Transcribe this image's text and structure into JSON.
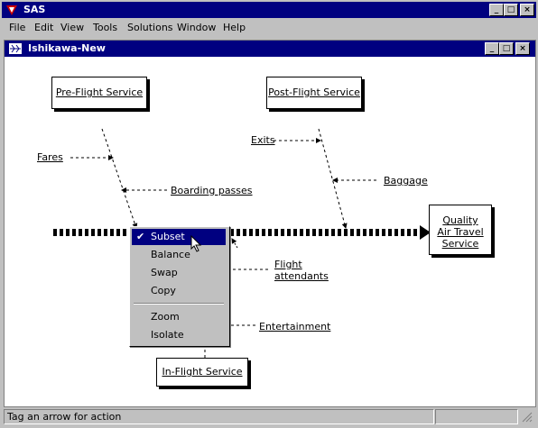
{
  "app": {
    "title": "SAS"
  },
  "menubar": [
    "File",
    "Edit",
    "View",
    "Tools",
    "Solutions",
    "Window",
    "Help"
  ],
  "child_window": {
    "title": "Ishikawa-New"
  },
  "diagram": {
    "effect": [
      "Quality",
      "Air Travel",
      "Service"
    ],
    "categories": {
      "pre_flight": "Pre-Flight Service",
      "post_flight": "Post-Flight Service",
      "in_flight": "In-Flight Service"
    },
    "causes": {
      "fares": "Fares",
      "boarding": "Boarding passes",
      "exits": "Exits",
      "baggage": "Baggage",
      "attendants_1": "Flight",
      "attendants_2": "attendants",
      "entertainment": "Entertainment"
    }
  },
  "context_menu": {
    "items": [
      "Subset",
      "Balance",
      "Swap",
      "Copy"
    ],
    "items2": [
      "Zoom",
      "Isolate"
    ],
    "selected": "Subset"
  },
  "status": {
    "text": "Tag an arrow for action"
  }
}
